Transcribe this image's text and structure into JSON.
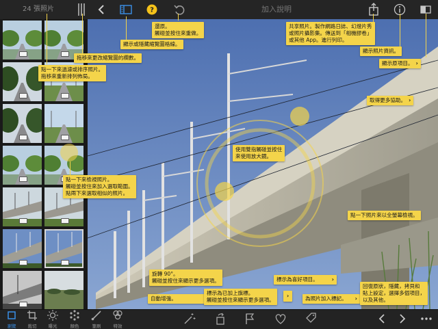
{
  "header": {
    "photo_count": "24 張照片",
    "title": "加入說明"
  },
  "toolbar_left": {
    "icons": [
      "chevron-left-icon",
      "sidebar-toggle-icon",
      "help-icon",
      "undo-icon"
    ]
  },
  "toolbar_right": {
    "icons": [
      "share-icon",
      "info-icon",
      "compare-icon"
    ]
  },
  "sidebar": {
    "thumbnails": [
      {
        "scene": "road-trees"
      },
      {
        "scene": "road-trees"
      },
      {
        "scene": "road-trees-dark"
      },
      {
        "scene": "road-sky"
      },
      {
        "scene": "road-trees-dark"
      },
      {
        "scene": "road-sky"
      },
      {
        "scene": "bridge"
      },
      {
        "scene": "bridge"
      },
      {
        "scene": "bridge-blue"
      },
      {
        "scene": "bridge-blue"
      },
      {
        "scene": "bridge-bw"
      },
      {
        "scene": "field"
      }
    ]
  },
  "callouts": {
    "revert": "還原。\n觸碰並按住來重做。",
    "show_grid": "顯示或隱藏縮覽圖格線。",
    "share": "共享照片。製作網路日誌、幻燈片秀\n或照片攝影集。傳送到「相機膠卷」\n或其他 App。進行列印。",
    "info": "顯示照片資訊。",
    "show_original": "顯示原項目。",
    "more_help": "取得更多協助。",
    "drag_columns": "拖移來更改縮覽圖的欄數。",
    "tap_filter": "點一下來過濾或排序照片。\n拖移來重新排列佈局。",
    "two_finger": "使用雙指觸碰並按住\n來使用放大鏡。",
    "tap_view": "點一下來檢視照片。\n觸碰並按住來加入選取範圍。\n點兩下來選取相似的照片。",
    "fullscreen": "點一下照片來以全螢幕檢視。",
    "rotate": "旋轉 90°。\n觸碰並按住來顯示更多選項。",
    "auto_enhance": "自動增強。",
    "flag": "標示為已加上旗標。\n觸碰並按住來顯示更多選項。",
    "favorite": "標示為喜好項目。",
    "tag": "為照片加入標記。",
    "more_options": "回復原狀，隱藏，拷貝和\n貼上設定，選擇多個項目，\n以及其他。"
  },
  "tools": [
    {
      "label": "瀏覽",
      "icon": "browse-icon",
      "active": true
    },
    {
      "label": "裁切",
      "icon": "crop-icon",
      "active": false
    },
    {
      "label": "曝光",
      "icon": "exposure-icon",
      "active": false
    },
    {
      "label": "顏色",
      "icon": "color-icon",
      "active": false
    },
    {
      "label": "筆刷",
      "icon": "brush-icon",
      "active": false
    },
    {
      "label": "特效",
      "icon": "effects-icon",
      "active": false
    }
  ],
  "colors": {
    "accent": "#3a90e8",
    "callout": "#f4d44a"
  }
}
